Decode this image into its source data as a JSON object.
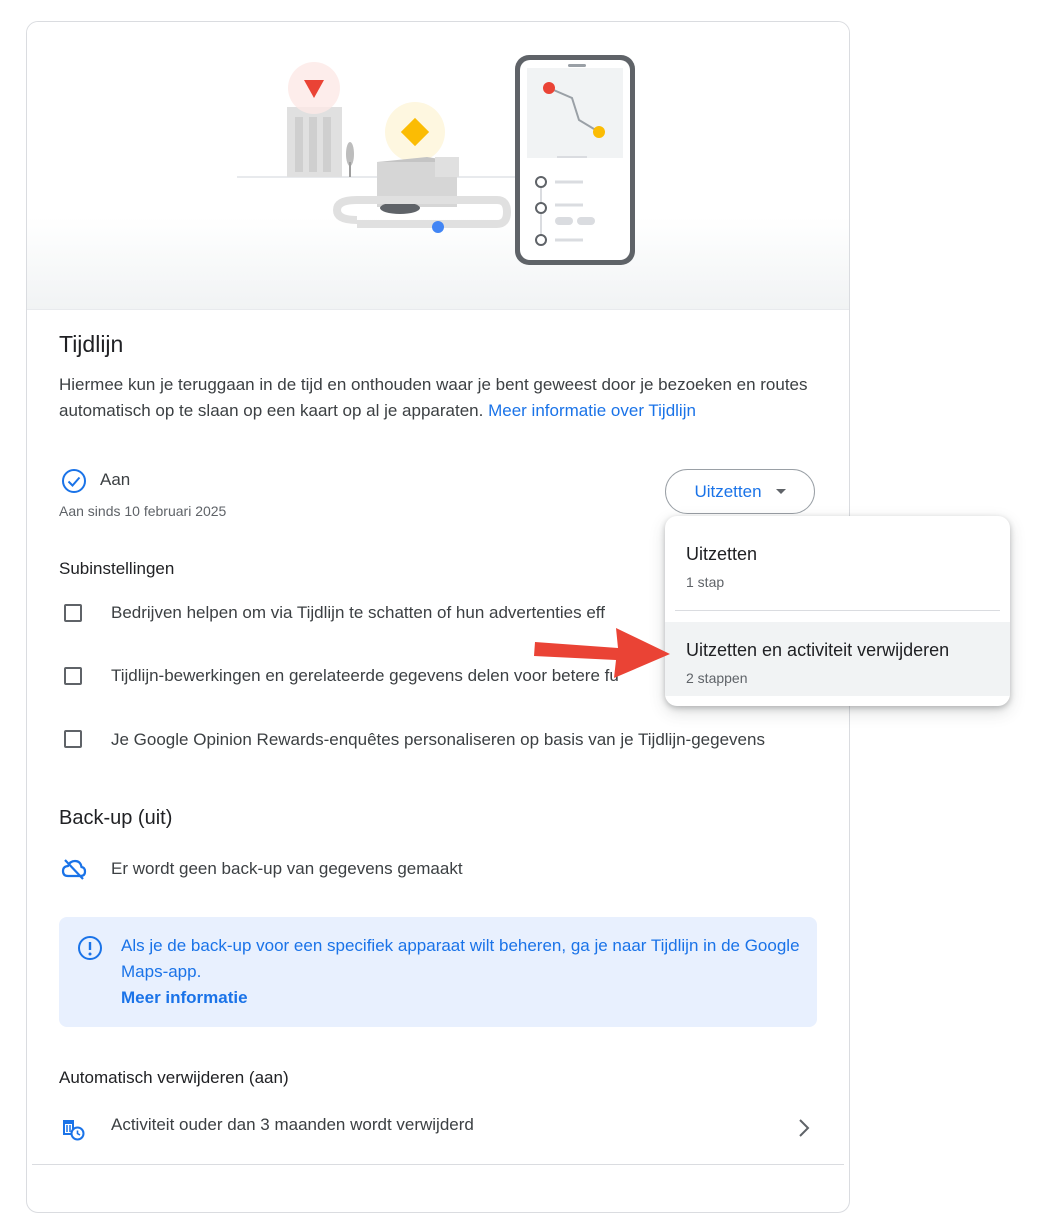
{
  "timeline": {
    "title": "Tijdlijn",
    "description": "Hiermee kun je teruggaan in de tijd en onthouden waar je bent geweest door je bezoeken en routes automatisch op te slaan op een kaart op al je apparaten.",
    "learn_more_link": "Meer informatie over Tijdlijn",
    "status": {
      "label": "Aan",
      "since": "Aan sinds 10 februari 2025",
      "icon": "check-circle-icon"
    },
    "off_button": {
      "label": "Uitzetten",
      "icon": "caret-down-icon"
    }
  },
  "dropdown": {
    "items": [
      {
        "title": "Uitzetten",
        "subtitle": "1 stap"
      },
      {
        "title": "Uitzetten en activiteit verwijderen",
        "subtitle": "2 stappen",
        "highlighted": true
      }
    ]
  },
  "subsettings": {
    "heading": "Subinstellingen",
    "items": [
      {
        "label": "Bedrijven helpen om via Tijdlijn te schatten of hun advertenties eff",
        "checked": false
      },
      {
        "label": "Tijdlijn-bewerkingen en gerelateerde gegevens delen voor betere fu",
        "checked": false
      },
      {
        "label": "Je Google Opinion Rewards-enquêtes personaliseren op basis van je Tijdlijn-gegevens",
        "checked": false
      }
    ]
  },
  "backup": {
    "heading": "Back-up (uit)",
    "text": "Er wordt geen back-up van gegevens gemaakt",
    "icon": "cloud-off-icon",
    "info": {
      "text": "Als je de back-up voor een specifiek apparaat wilt beheren, ga je naar Tijdlijn in de Google Maps-app.",
      "link": "Meer informatie",
      "icon": "info-icon"
    }
  },
  "autodelete": {
    "heading": "Automatisch verwijderen (aan)",
    "text": "Activiteit ouder dan 3 maanden wordt verwijderd",
    "icon": "auto-delete-icon",
    "chevron": "chevron-right-icon"
  },
  "colors": {
    "accent": "#1a73e8",
    "arrow": "#ea4335",
    "info_bg": "#e8f0fe"
  }
}
